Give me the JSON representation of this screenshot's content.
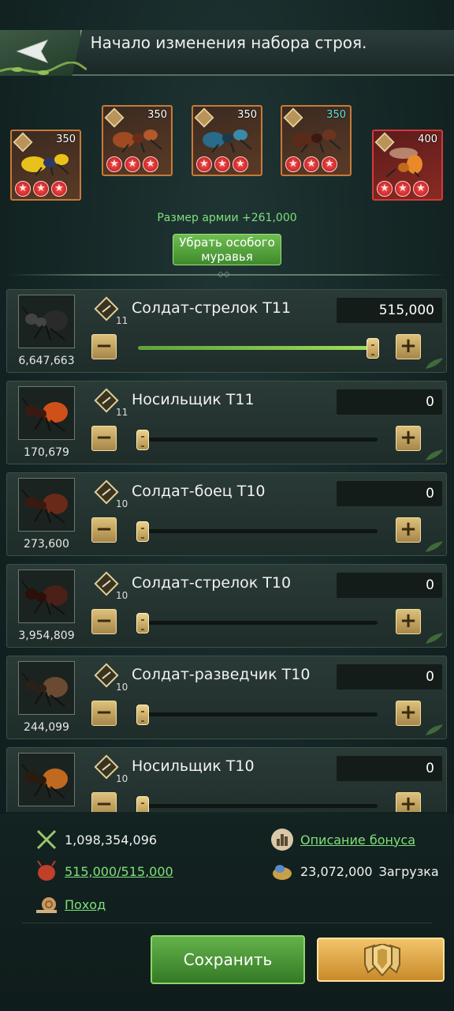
{
  "header": {
    "title": "Начало изменения набора строя."
  },
  "special_ants": [
    {
      "value": "350"
    },
    {
      "value": "350"
    },
    {
      "value": "350"
    },
    {
      "value": "350"
    },
    {
      "value": "400"
    }
  ],
  "army_size": "Размер армии +261,000",
  "remove_button": "Убрать особого муравья",
  "troops": [
    {
      "name": "Солдат-стрелок Т11",
      "tier": "11",
      "count": "6,647,663",
      "quantity": "515,000",
      "fill": 1.0
    },
    {
      "name": "Носильщик Т11",
      "tier": "11",
      "count": "170,679",
      "quantity": "0",
      "fill": 0
    },
    {
      "name": "Солдат-боец Т10",
      "tier": "10",
      "count": "273,600",
      "quantity": "0",
      "fill": 0
    },
    {
      "name": "Солдат-стрелок Т10",
      "tier": "10",
      "count": "3,954,809",
      "quantity": "0",
      "fill": 0
    },
    {
      "name": "Солдат-разведчик Т10",
      "tier": "10",
      "count": "244,099",
      "quantity": "0",
      "fill": 0
    },
    {
      "name": "Носильщик Т10",
      "tier": "10",
      "count": "",
      "quantity": "0",
      "fill": 0
    }
  ],
  "bottom": {
    "power": "1,098,354,096",
    "troops_capacity": "515,000/515,000",
    "march_link": "Поход",
    "bonus_link": "Описание бонуса",
    "load_value": "23,072,000",
    "load_label": "Загрузка",
    "save_button": "Сохранить"
  },
  "colors": {
    "accent_green": "#7fe07a",
    "gold": "#dcc17a",
    "special_border": "#c67a3a",
    "special_red": "#d43a3a"
  }
}
